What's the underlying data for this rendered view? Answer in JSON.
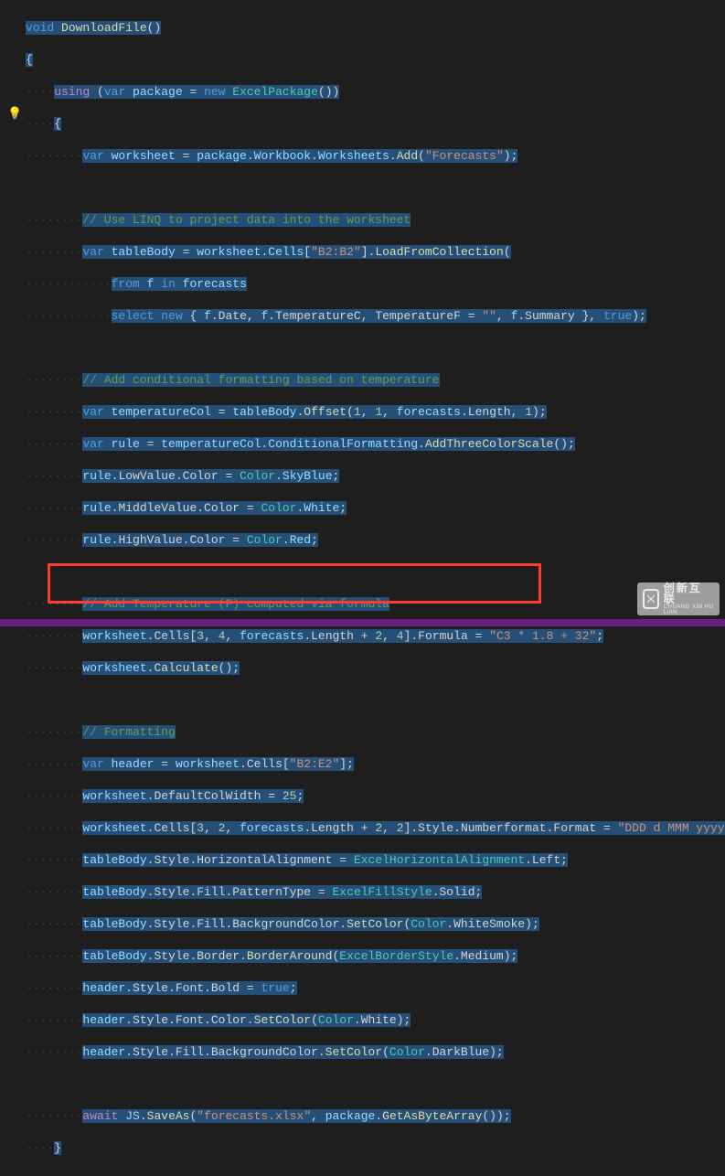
{
  "watermark": {
    "zh": "创新互联",
    "en": "CHUANG XIN HU LIAN"
  },
  "code": {
    "l1": {
      "void": "void",
      "name": " DownloadFile",
      "paren": "()"
    },
    "l2": {
      "brace": "{"
    },
    "l3": {
      "using": "using",
      "op": " (",
      "var": "var",
      "pkg": " package",
      "eq": " = ",
      "new": "new",
      "type": " ExcelPackage",
      "rest": "())"
    },
    "l4": {
      "brace": "{"
    },
    "l5": {
      "var": "var",
      "ws": " worksheet",
      "eq": " = ",
      "pkg": "package",
      "dot1": ".",
      "wb": "Workbook",
      "dot2": ".",
      "wss": "Worksheets",
      "dot3": ".",
      "add": "Add",
      "op": "(",
      "str": "\"Forecasts\"",
      "end": ");"
    },
    "l6": {
      "comment": "// Use LINQ to project data into the worksheet"
    },
    "l7": {
      "var": "var",
      "tb": " tableBody",
      "eq": " = ",
      "ws": "worksheet",
      "dot": ".",
      "cells": "Cells",
      "br": "[",
      "str": "\"B2:B2\"",
      "br2": "].",
      "load": "LoadFromCollection",
      "paren": "("
    },
    "l8": {
      "from": "from",
      "f": " f ",
      "in": "in",
      "rest": " forecasts"
    },
    "l9": {
      "select": "select",
      "sp": " ",
      "new": "new",
      "op": " { ",
      "f1": "f",
      "d1": ".Date, ",
      "f2": "f",
      "d2": ".TemperatureC, TemperatureF = ",
      "str": "\"\"",
      "d3": ", ",
      "f3": "f",
      "d4": ".Summary }, ",
      "true": "true",
      "end": ");"
    },
    "l10": {
      "comment": "// Add conditional formatting based on temperature"
    },
    "l11": {
      "var": "var",
      "tc": " temperatureCol",
      "eq": " = ",
      "tb": "tableBody",
      "dot": ".",
      "off": "Offset",
      "args": "(",
      "n1": "1",
      "c1": ", ",
      "n2": "1",
      "c2": ", ",
      "fc": "forecasts",
      "len": ".Length, ",
      "n3": "1",
      "end": ");"
    },
    "l12": {
      "var": "var",
      "r": " rule",
      "eq": " = ",
      "tc": "temperatureCol",
      "dot": ".",
      "cf": "ConditionalFormatting",
      "dot2": ".",
      "add": "AddThreeColorScale",
      "end": "();"
    },
    "l13": {
      "r": "rule",
      "p": ".LowValue.Color = ",
      "c": "Color",
      "dot": ".",
      "v": "SkyBlue",
      "end": ";"
    },
    "l14": {
      "r": "rule",
      "p": ".MiddleValue.Color = ",
      "c": "Color",
      "dot": ".",
      "v": "White",
      "end": ";"
    },
    "l15": {
      "r": "rule",
      "p": ".HighValue.Color = ",
      "c": "Color",
      "dot": ".",
      "v": "Red",
      "end": ";"
    },
    "l16": {
      "comment": "// Add Temperature (F) computed via formula"
    },
    "l17": {
      "ws": "worksheet",
      "c": ".Cells[",
      "n1": "3",
      "c1": ", ",
      "n2": "4",
      "c2": ", ",
      "fc": "forecasts",
      "len": ".Length + ",
      "n3": "2",
      "c3": ", ",
      "n4": "4",
      "br": "].Formula = ",
      "str": "\"C3 * 1.8 + 32\"",
      "end": ";"
    },
    "l18": {
      "ws": "worksheet",
      "dot": ".",
      "calc": "Calculate",
      "end": "();"
    },
    "l19": {
      "comment": "// Formatting"
    },
    "l20": {
      "var": "var",
      "h": " header",
      "eq": " = ",
      "ws": "worksheet",
      "c": ".Cells[",
      "str": "\"B2:E2\"",
      "end": "];"
    },
    "l21": {
      "ws": "worksheet",
      "p": ".DefaultColWidth = ",
      "n": "25",
      "end": ";"
    },
    "l22": {
      "ws": "worksheet",
      "c": ".Cells[",
      "n1": "3",
      "c1": ", ",
      "n2": "2",
      "c2": ", ",
      "fc": "forecasts",
      "len": ".Length + ",
      "n3": "2",
      "c3": ", ",
      "n4": "2",
      "br": "].Style.Numberformat.Format = ",
      "str": "\"DDD d MMM yyyy\"",
      "end": ";"
    },
    "l23": {
      "tb": "tableBody",
      "p": ".Style.HorizontalAlignment = ",
      "t": "ExcelHorizontalAlignment",
      "v": ".Left;"
    },
    "l24": {
      "tb": "tableBody",
      "p": ".Style.Fill.PatternType = ",
      "t": "ExcelFillStyle",
      "v": ".Solid;"
    },
    "l25": {
      "tb": "tableBody",
      "p": ".Style.Fill.BackgroundColor.",
      "m": "SetColor",
      "op": "(",
      "c": "Color",
      "v": ".WhiteSmoke);"
    },
    "l26": {
      "tb": "tableBody",
      "p": ".Style.Border.",
      "m": "BorderAround",
      "op": "(",
      "t": "ExcelBorderStyle",
      "v": ".Medium);"
    },
    "l27": {
      "h": "header",
      "p": ".Style.Font.Bold = ",
      "true": "true",
      "end": ";"
    },
    "l28": {
      "h": "header",
      "p": ".Style.Font.Color.",
      "m": "SetColor",
      "op": "(",
      "c": "Color",
      "v": ".White);"
    },
    "l29": {
      "h": "header",
      "p": ".Style.Fill.BackgroundColor.",
      "m": "SetColor",
      "op": "(",
      "c": "Color",
      "v": ".DarkBlue);"
    },
    "l30": {
      "await": "await",
      "sp": " ",
      "js": "JS",
      "dot": ".",
      "save": "SaveAs",
      "op": "(",
      "str": "\"forecasts.xlsx\"",
      "c": ", ",
      "pkg": "package",
      "dot2": ".",
      "get": "GetAsByteArray",
      "end": "());"
    },
    "l31": {
      "brace": "}"
    }
  }
}
